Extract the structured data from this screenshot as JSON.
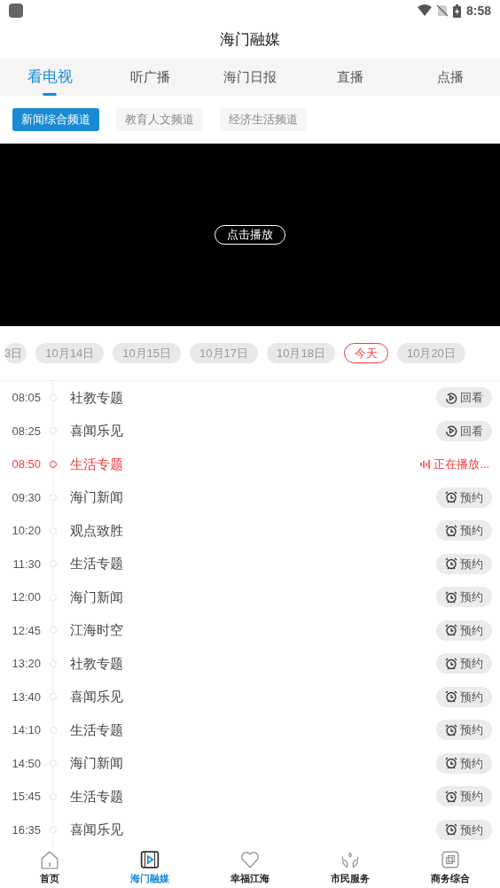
{
  "status_bar": {
    "time": "8:58"
  },
  "title": "海门融媒",
  "tabs": [
    {
      "label": "看电视",
      "selected": true
    },
    {
      "label": "听广播",
      "selected": false
    },
    {
      "label": "海门日报",
      "selected": false
    },
    {
      "label": "直播",
      "selected": false
    },
    {
      "label": "点播",
      "selected": false
    }
  ],
  "channels": [
    {
      "label": "新闻综合频道",
      "selected": true
    },
    {
      "label": "教育人文频道",
      "selected": false
    },
    {
      "label": "经济生活频道",
      "selected": false
    }
  ],
  "video": {
    "play_label": "点击播放"
  },
  "dates": [
    {
      "label": "3日",
      "selected": false
    },
    {
      "label": "10月14日",
      "selected": false
    },
    {
      "label": "10月15日",
      "selected": false
    },
    {
      "label": "10月17日",
      "selected": false
    },
    {
      "label": "10月18日",
      "selected": false
    },
    {
      "label": "今天",
      "selected": true
    },
    {
      "label": "10月20日",
      "selected": false
    }
  ],
  "schedule": [
    {
      "time": "08:05",
      "title": "社教专题",
      "kind": "replay",
      "action": "回看"
    },
    {
      "time": "08:25",
      "title": "喜闻乐见",
      "kind": "replay",
      "action": "回看"
    },
    {
      "time": "08:50",
      "title": "生活专题",
      "kind": "live",
      "action": "正在播放..."
    },
    {
      "time": "09:30",
      "title": "海门新闻",
      "kind": "reserve",
      "action": "预约"
    },
    {
      "time": "10:20",
      "title": "观点致胜",
      "kind": "reserve",
      "action": "预约"
    },
    {
      "time": "11:30",
      "title": "生活专题",
      "kind": "reserve",
      "action": "预约"
    },
    {
      "time": "12:00",
      "title": "海门新闻",
      "kind": "reserve",
      "action": "预约"
    },
    {
      "time": "12:45",
      "title": "江海时空",
      "kind": "reserve",
      "action": "预约"
    },
    {
      "time": "13:20",
      "title": "社教专题",
      "kind": "reserve",
      "action": "预约"
    },
    {
      "time": "13:40",
      "title": "喜闻乐见",
      "kind": "reserve",
      "action": "预约"
    },
    {
      "time": "14:10",
      "title": "生活专题",
      "kind": "reserve",
      "action": "预约"
    },
    {
      "time": "14:50",
      "title": "海门新闻",
      "kind": "reserve",
      "action": "预约"
    },
    {
      "time": "15:45",
      "title": "生活专题",
      "kind": "reserve",
      "action": "预约"
    },
    {
      "time": "16:35",
      "title": "喜闻乐见",
      "kind": "reserve",
      "action": "预约"
    }
  ],
  "bottom_nav": [
    {
      "label": "首页",
      "kind": "home",
      "selected": false
    },
    {
      "label": "海门融媒",
      "kind": "media",
      "selected": true
    },
    {
      "label": "幸福江海",
      "kind": "happiness",
      "selected": false
    },
    {
      "label": "市民服务",
      "kind": "service",
      "selected": false
    },
    {
      "label": "商务综合",
      "kind": "business",
      "selected": false
    }
  ]
}
